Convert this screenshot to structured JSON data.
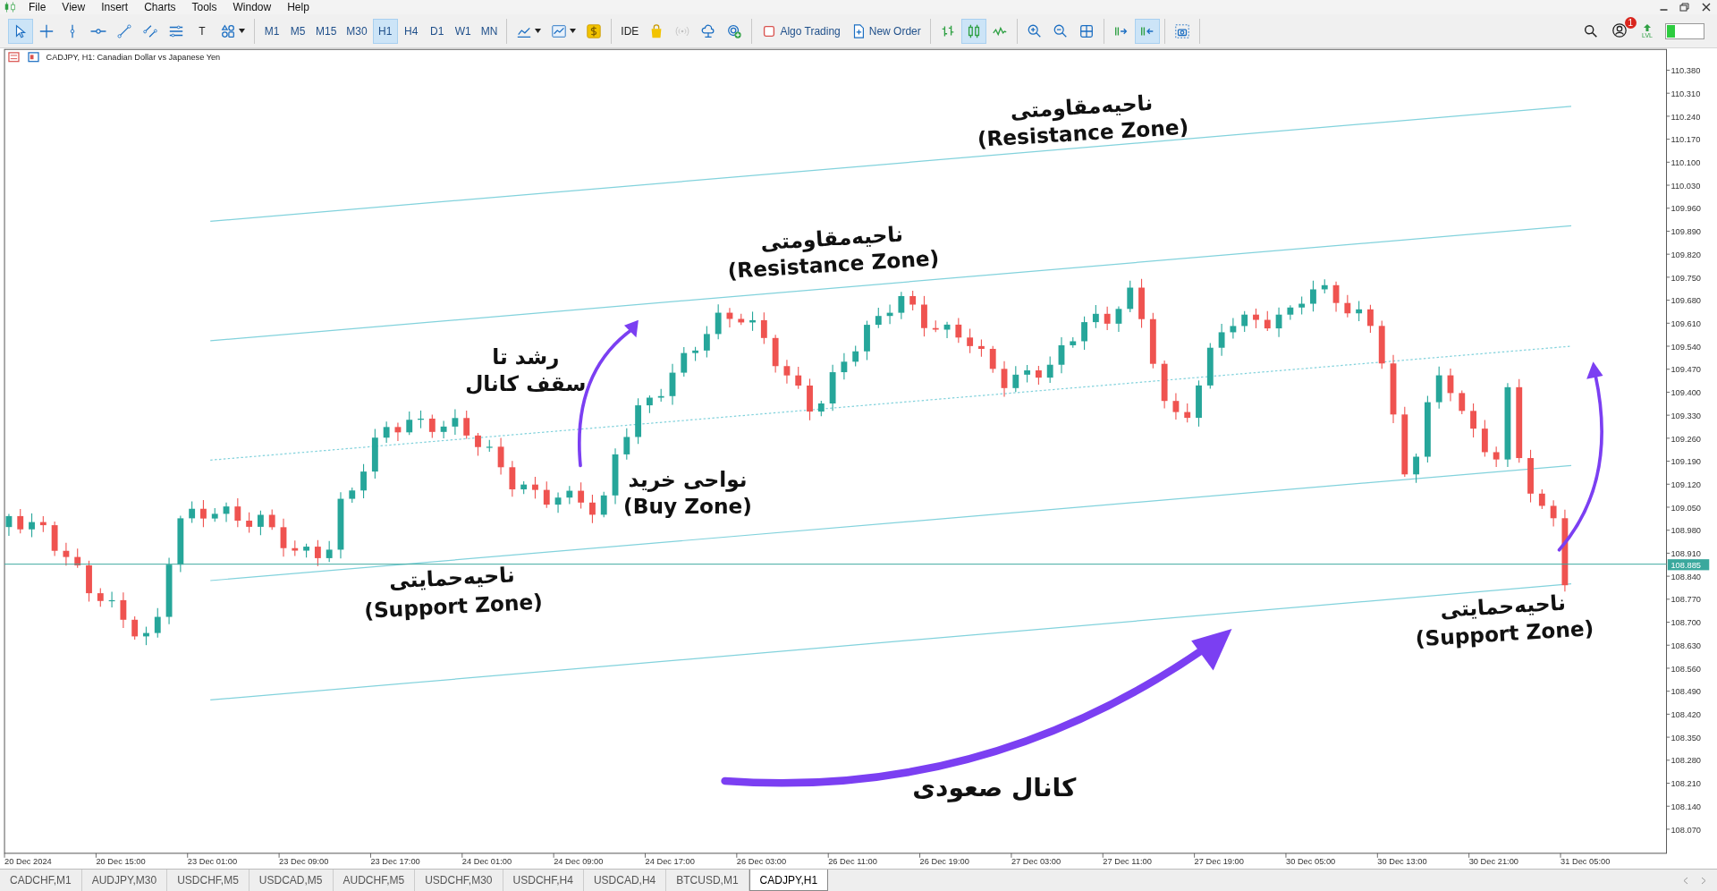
{
  "menu_bar": {
    "items": [
      "File",
      "View",
      "Insert",
      "Charts",
      "Tools",
      "Window",
      "Help"
    ]
  },
  "toolbar": {
    "groups": [
      [
        {
          "selected": true
        },
        {
          "selected": false
        },
        {
          "selected": false
        },
        {
          "selected": false
        },
        {
          "selected": false
        },
        {
          "selected": false
        },
        {
          "selected": false
        },
        {
          "label": "T",
          "selected": false
        },
        {
          "selected": false,
          "dropdown": true
        }
      ],
      [
        {
          "label": "M1",
          "selected": false
        },
        {
          "label": "M5",
          "selected": false
        },
        {
          "label": "M15",
          "selected": false
        },
        {
          "label": "M30",
          "selected": false
        },
        {
          "label": "H1",
          "selected": true
        },
        {
          "label": "H4",
          "selected": false
        },
        {
          "label": "D1",
          "selected": false
        },
        {
          "label": "W1",
          "selected": false
        },
        {
          "label": "MN",
          "selected": false
        }
      ],
      [
        {
          "selected": false,
          "dropdown": true
        },
        {
          "selected": false,
          "dropdown": true
        },
        {
          "selected": false
        }
      ],
      [
        {
          "label": "IDE",
          "selected": false
        },
        {
          "selected": false
        },
        {
          "selected": false,
          "disabled": true
        },
        {
          "selected": false
        },
        {
          "selected": false
        }
      ],
      [
        {
          "label": "Algo Trading",
          "selected": false
        },
        {
          "label": "New Order",
          "selected": false
        }
      ],
      [
        {
          "selected": false
        },
        {
          "selected": true
        },
        {
          "selected": false
        }
      ],
      [
        {
          "selected": false
        },
        {
          "selected": false
        },
        {
          "selected": false
        }
      ],
      [
        {
          "selected": false
        },
        {
          "selected": true
        }
      ],
      [
        {
          "selected": false
        }
      ]
    ]
  },
  "account": {
    "notifications": "1",
    "level_label": "LVL"
  },
  "chart": {
    "title": "CADJPY, H1:  Canadian Dollar vs Japanese Yen",
    "price_labels": [
      "110.380",
      "110.310",
      "110.240",
      "110.170",
      "110.100",
      "110.030",
      "109.960",
      "109.890",
      "109.820",
      "109.750",
      "109.680",
      "109.610",
      "109.540",
      "109.470",
      "109.400",
      "109.330",
      "109.260",
      "109.190",
      "109.120",
      "109.050",
      "108.980",
      "108.910",
      "108.840",
      "108.770",
      "108.700",
      "108.630",
      "108.560",
      "108.490",
      "108.420",
      "108.350",
      "108.280",
      "108.210",
      "108.140",
      "108.070"
    ],
    "current_price": "108.885",
    "time_labels": [
      "20 Dec 2024",
      "20 Dec 15:00",
      "23 Dec 01:00",
      "23 Dec 09:00",
      "23 Dec 17:00",
      "24 Dec 01:00",
      "24 Dec 09:00",
      "24 Dec 17:00",
      "26 Dec 03:00",
      "26 Dec 11:00",
      "26 Dec 19:00",
      "27 Dec 03:00",
      "27 Dec 11:00",
      "27 Dec 19:00",
      "30 Dec 05:00",
      "30 Dec 13:00",
      "30 Dec 21:00",
      "31 Dec 05:00"
    ],
    "annotations": [
      {
        "lines": [
          "ناحیه‌مقاومتی",
          "(Resistance Zone)"
        ]
      },
      {
        "lines": [
          "ناحیه‌مقاومتی",
          "(Resistance Zone)"
        ]
      },
      {
        "lines": [
          "رشد تا",
          "سقف کانال"
        ]
      },
      {
        "lines": [
          "نواحی خرید",
          "(Buy Zone)"
        ]
      },
      {
        "lines": [
          "ناحیه‌حمایتی",
          "(Support Zone)"
        ]
      },
      {
        "lines": [
          "ناحیه‌حمایتی",
          "(Support Zone)"
        ]
      },
      {
        "lines": [
          "کانال صعودی"
        ]
      }
    ]
  },
  "tabs": [
    {
      "label": "CADCHF,M1",
      "selected": false
    },
    {
      "label": "AUDJPY,M30",
      "selected": false
    },
    {
      "label": "USDCHF,M5",
      "selected": false
    },
    {
      "label": "USDCAD,M5",
      "selected": false
    },
    {
      "label": "AUDCHF,M5",
      "selected": false
    },
    {
      "label": "USDCHF,M30",
      "selected": false
    },
    {
      "label": "USDCHF,H4",
      "selected": false
    },
    {
      "label": "USDCAD,H4",
      "selected": false
    },
    {
      "label": "BTCUSD,M1",
      "selected": false
    },
    {
      "label": "CADJPY,H1",
      "selected": true
    }
  ]
}
